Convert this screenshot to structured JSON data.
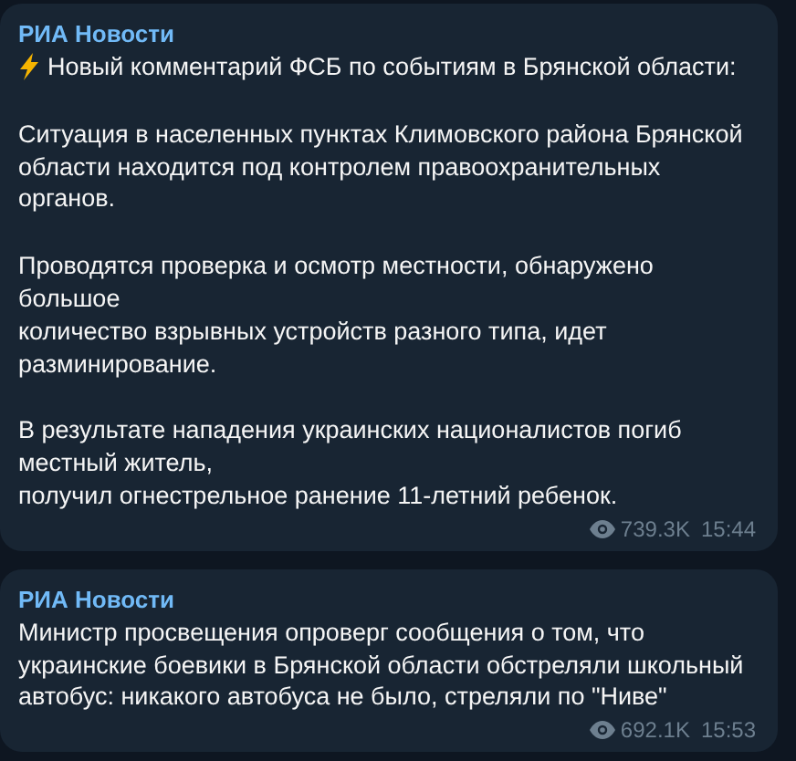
{
  "messages": [
    {
      "author": "РИА Новости",
      "paragraphs": [
        {
          "kind": "lightning",
          "text": "Новый комментарий ФСБ по событиям в Брянской области:"
        },
        {
          "text": "Ситуация в населенных пунктах Климовского района Брянской\nобласти находится под контролем правоохранительных\nорганов."
        },
        {
          "text": "Проводятся проверка и осмотр местности, обнаружено\nбольшое\nколичество взрывных устройств разного типа, идет\nразминирование."
        },
        {
          "text": "В результате нападения украинских националистов погиб\nместный житель,\nполучил огнестрельное ранение 11-летний ребенок."
        }
      ],
      "views": "739.3K",
      "time": "15:44"
    },
    {
      "author": "РИА Новости",
      "paragraphs": [
        {
          "text": "Министр просвещения опроверг сообщения о том, что\nукраинские боевики в Брянской области обстреляли школьный\nавтобус: никакого автобуса не было, стреляли по \"Ниве\""
        }
      ],
      "views": "692.1K",
      "time": "15:53"
    }
  ]
}
